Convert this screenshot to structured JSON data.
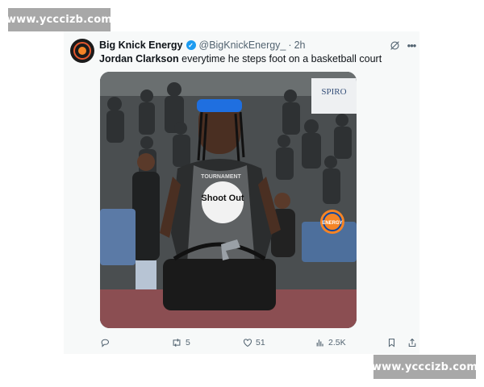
{
  "watermarks": {
    "top": "www.ycccizb.com",
    "bottom": "www.ycccizb.com"
  },
  "tweet": {
    "author_name": "Big Knick Energy",
    "handle": "@BigKnickEnergy_",
    "separator": "·",
    "time": "2h",
    "verified": true,
    "text_bold": "Jordan Clarkson",
    "text_rest": " everytime he steps foot on a basketball court",
    "media": {
      "sign_text": "SPIRO",
      "jersey_text_top": "TOURNAMENT",
      "jersey_logo": "Shoot Out",
      "overlay_logo": "ENERGY",
      "overlay_logo_color": "#f58426"
    }
  },
  "actions": {
    "replies": "",
    "retweets": "5",
    "likes": "51",
    "views": "2.5K"
  },
  "icons": {
    "grok": "grok-icon",
    "more": "more-icon",
    "reply": "reply-icon",
    "retweet": "retweet-icon",
    "like": "like-icon",
    "views": "views-icon",
    "bookmark": "bookmark-icon",
    "share": "share-icon"
  },
  "colors": {
    "verified_badge": "#1d9bf0",
    "secondary_text": "#536471",
    "card_background": "#f7f9f9"
  }
}
